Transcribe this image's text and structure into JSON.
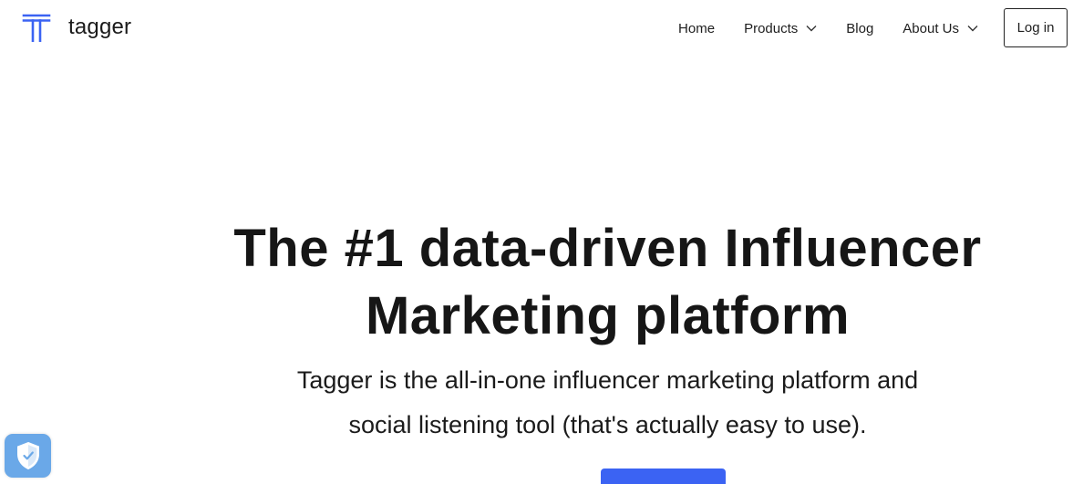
{
  "brand": {
    "name": "tagger",
    "logo_icon": "tagger-t-logo-icon",
    "logo_color": "#3b63f3"
  },
  "nav": {
    "items": [
      {
        "label": "Home",
        "has_dropdown": false
      },
      {
        "label": "Products",
        "has_dropdown": true,
        "icon": "chevron-down-icon"
      },
      {
        "label": "Blog",
        "has_dropdown": false
      },
      {
        "label": "About Us",
        "has_dropdown": true,
        "icon": "chevron-down-icon"
      }
    ],
    "login_label": "Log in"
  },
  "hero": {
    "title_lines": [
      "The #1 data-driven Influencer",
      "Marketing platform"
    ],
    "subtitle_lines": [
      "Tagger is the all-in-one influencer marketing platform and",
      "social listening tool (that's actually easy to use)."
    ],
    "cta_color": "#3b63f3"
  },
  "widget": {
    "icon": "shield-check-icon",
    "color": "#6aa8e8"
  }
}
